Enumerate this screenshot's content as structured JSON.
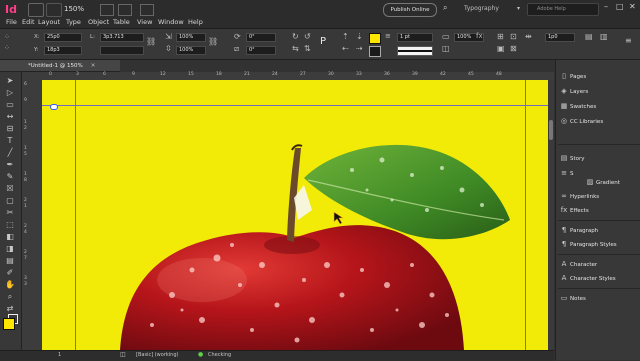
{
  "app": {
    "logo_text": "Id",
    "zoom": "150%",
    "menus": [
      "File",
      "Edit",
      "Layout",
      "Type",
      "Object",
      "Table",
      "View",
      "Window",
      "Help"
    ],
    "publish_label": "Publish Online",
    "workspace_label": "Typography",
    "help_placeholder": "Adobe Help",
    "window_controls": [
      "–",
      "□",
      "✕"
    ]
  },
  "control": {
    "x_label": "X:",
    "x_value": "25p0",
    "y_label": "Y:",
    "y_value": "18p3",
    "l_label": "L:",
    "l_value": "3p3.713",
    "scale_x": "100%",
    "scale_y": "100%",
    "rotate": "0°",
    "shear": "0°",
    "stroke_weight": "1 pt",
    "opacity": "100%",
    "spacing": "1p0",
    "accent_fill": "#ffe600"
  },
  "document": {
    "tab_title": "*Untitled-1 @ 150%",
    "close_glyph": "✕",
    "ruler_top": [
      "0",
      "3",
      "6",
      "9",
      "12",
      "15",
      "18",
      "21",
      "24",
      "27",
      "30",
      "33",
      "36",
      "39",
      "42",
      "45",
      "48"
    ],
    "ruler_left": [
      "6",
      "9",
      "1",
      "2",
      "1",
      "5",
      "1",
      "8",
      "2",
      "1",
      "2",
      "4",
      "2",
      "7",
      "3",
      "3"
    ],
    "page_color": "#f1eb07"
  },
  "status": {
    "page_number": "1",
    "style_label": "[Basic] (working)",
    "preflight": "Checking"
  },
  "panels": [
    {
      "label": "Pages",
      "icon": "pages-icon"
    },
    {
      "label": "Layers",
      "icon": "layers-icon"
    },
    {
      "label": "Swatches",
      "icon": "swatches-icon"
    },
    {
      "label": "CC Libraries",
      "icon": "cc-libraries-icon"
    },
    {
      "label": "Story",
      "icon": "story-icon"
    },
    {
      "label": "S",
      "icon": "stroke-icon"
    },
    {
      "label": "Gradient",
      "icon": "gradient-icon"
    },
    {
      "label": "Hyperlinks",
      "icon": "hyperlinks-icon"
    },
    {
      "label": "Effects",
      "icon": "effects-icon"
    },
    {
      "label": "Paragraph",
      "icon": "paragraph-icon"
    },
    {
      "label": "Paragraph Styles",
      "icon": "paragraph-styles-icon"
    },
    {
      "label": "Character",
      "icon": "character-icon"
    },
    {
      "label": "Character Styles",
      "icon": "character-styles-icon"
    },
    {
      "label": "Notes",
      "icon": "notes-icon"
    }
  ]
}
